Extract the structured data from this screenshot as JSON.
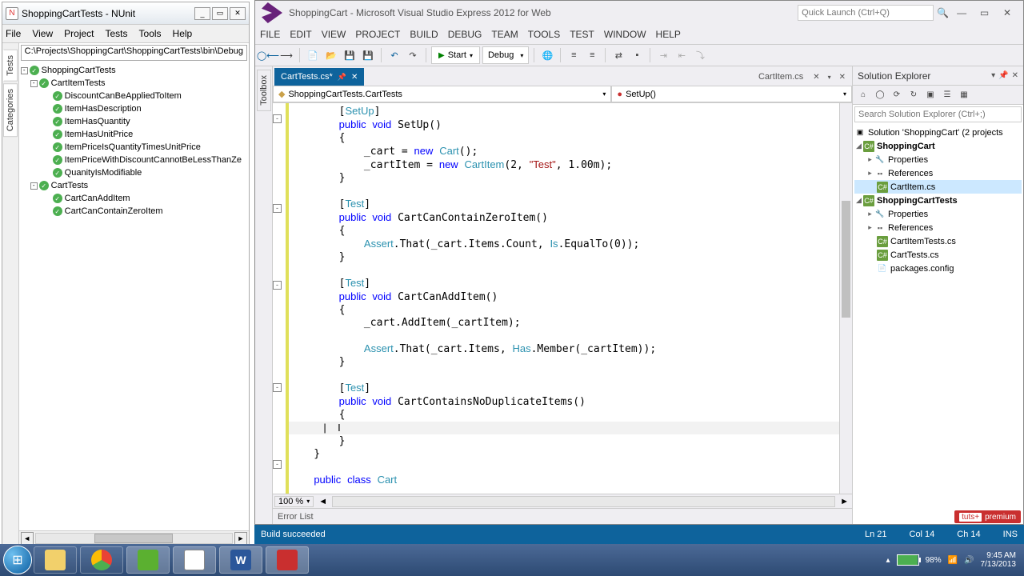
{
  "nunit": {
    "title": "ShoppingCartTests - NUnit",
    "menu": [
      "File",
      "View",
      "Project",
      "Tests",
      "Tools",
      "Help"
    ],
    "sidetabs": [
      "Tests",
      "Categories"
    ],
    "path": "C:\\Projects\\ShoppingCart\\ShoppingCartTests\\bin\\Debug",
    "tree": {
      "root": "ShoppingCartTests",
      "groups": [
        {
          "name": "CartItemTests",
          "tests": [
            "DiscountCanBeAppliedToItem",
            "ItemHasDescription",
            "ItemHasQuantity",
            "ItemHasUnitPrice",
            "ItemPriceIsQuantityTimesUnitPrice",
            "ItemPriceWithDiscountCannotBeLessThanZe",
            "QuanityIsModifiable"
          ]
        },
        {
          "name": "CartTests",
          "tests": [
            "CartCanAddItem",
            "CartCanContainZeroItem"
          ]
        }
      ]
    }
  },
  "vs": {
    "title": "ShoppingCart - Microsoft Visual Studio Express 2012 for Web",
    "quick_launch_placeholder": "Quick Launch (Ctrl+Q)",
    "menu": [
      "FILE",
      "EDIT",
      "VIEW",
      "PROJECT",
      "BUILD",
      "DEBUG",
      "TEAM",
      "TOOLS",
      "TEST",
      "WINDOW",
      "HELP"
    ],
    "start_label": "Start",
    "config": "Debug",
    "tabs": {
      "active": "CartTests.cs*",
      "inactive": "CartItem.cs"
    },
    "combo_left": "ShoppingCartTests.CartTests",
    "combo_right": "SetUp()",
    "zoom": "100 %",
    "error_list": "Error List",
    "cursor": {
      "ln": "Ln 21",
      "col": "Col 14",
      "ch": "Ch 14",
      "ins": "INS"
    }
  },
  "solution": {
    "title": "Solution Explorer",
    "search_placeholder": "Search Solution Explorer (Ctrl+;)",
    "root": "Solution 'ShoppingCart' (2 projects",
    "projects": [
      {
        "name": "ShoppingCart",
        "items": [
          "Properties",
          "References",
          "CartItem.cs"
        ]
      },
      {
        "name": "ShoppingCartTests",
        "items": [
          "Properties",
          "References",
          "CartItemTests.cs",
          "CartTests.cs",
          "packages.config"
        ]
      }
    ]
  },
  "status": {
    "build": "Build succeeded"
  },
  "premium": {
    "tuts": "tuts+",
    "label": "premium"
  },
  "tray": {
    "battery_pct": "98%",
    "time": "9:45 AM",
    "date": "7/13/2013"
  },
  "dock": {
    "toolbox": "Toolbox"
  }
}
